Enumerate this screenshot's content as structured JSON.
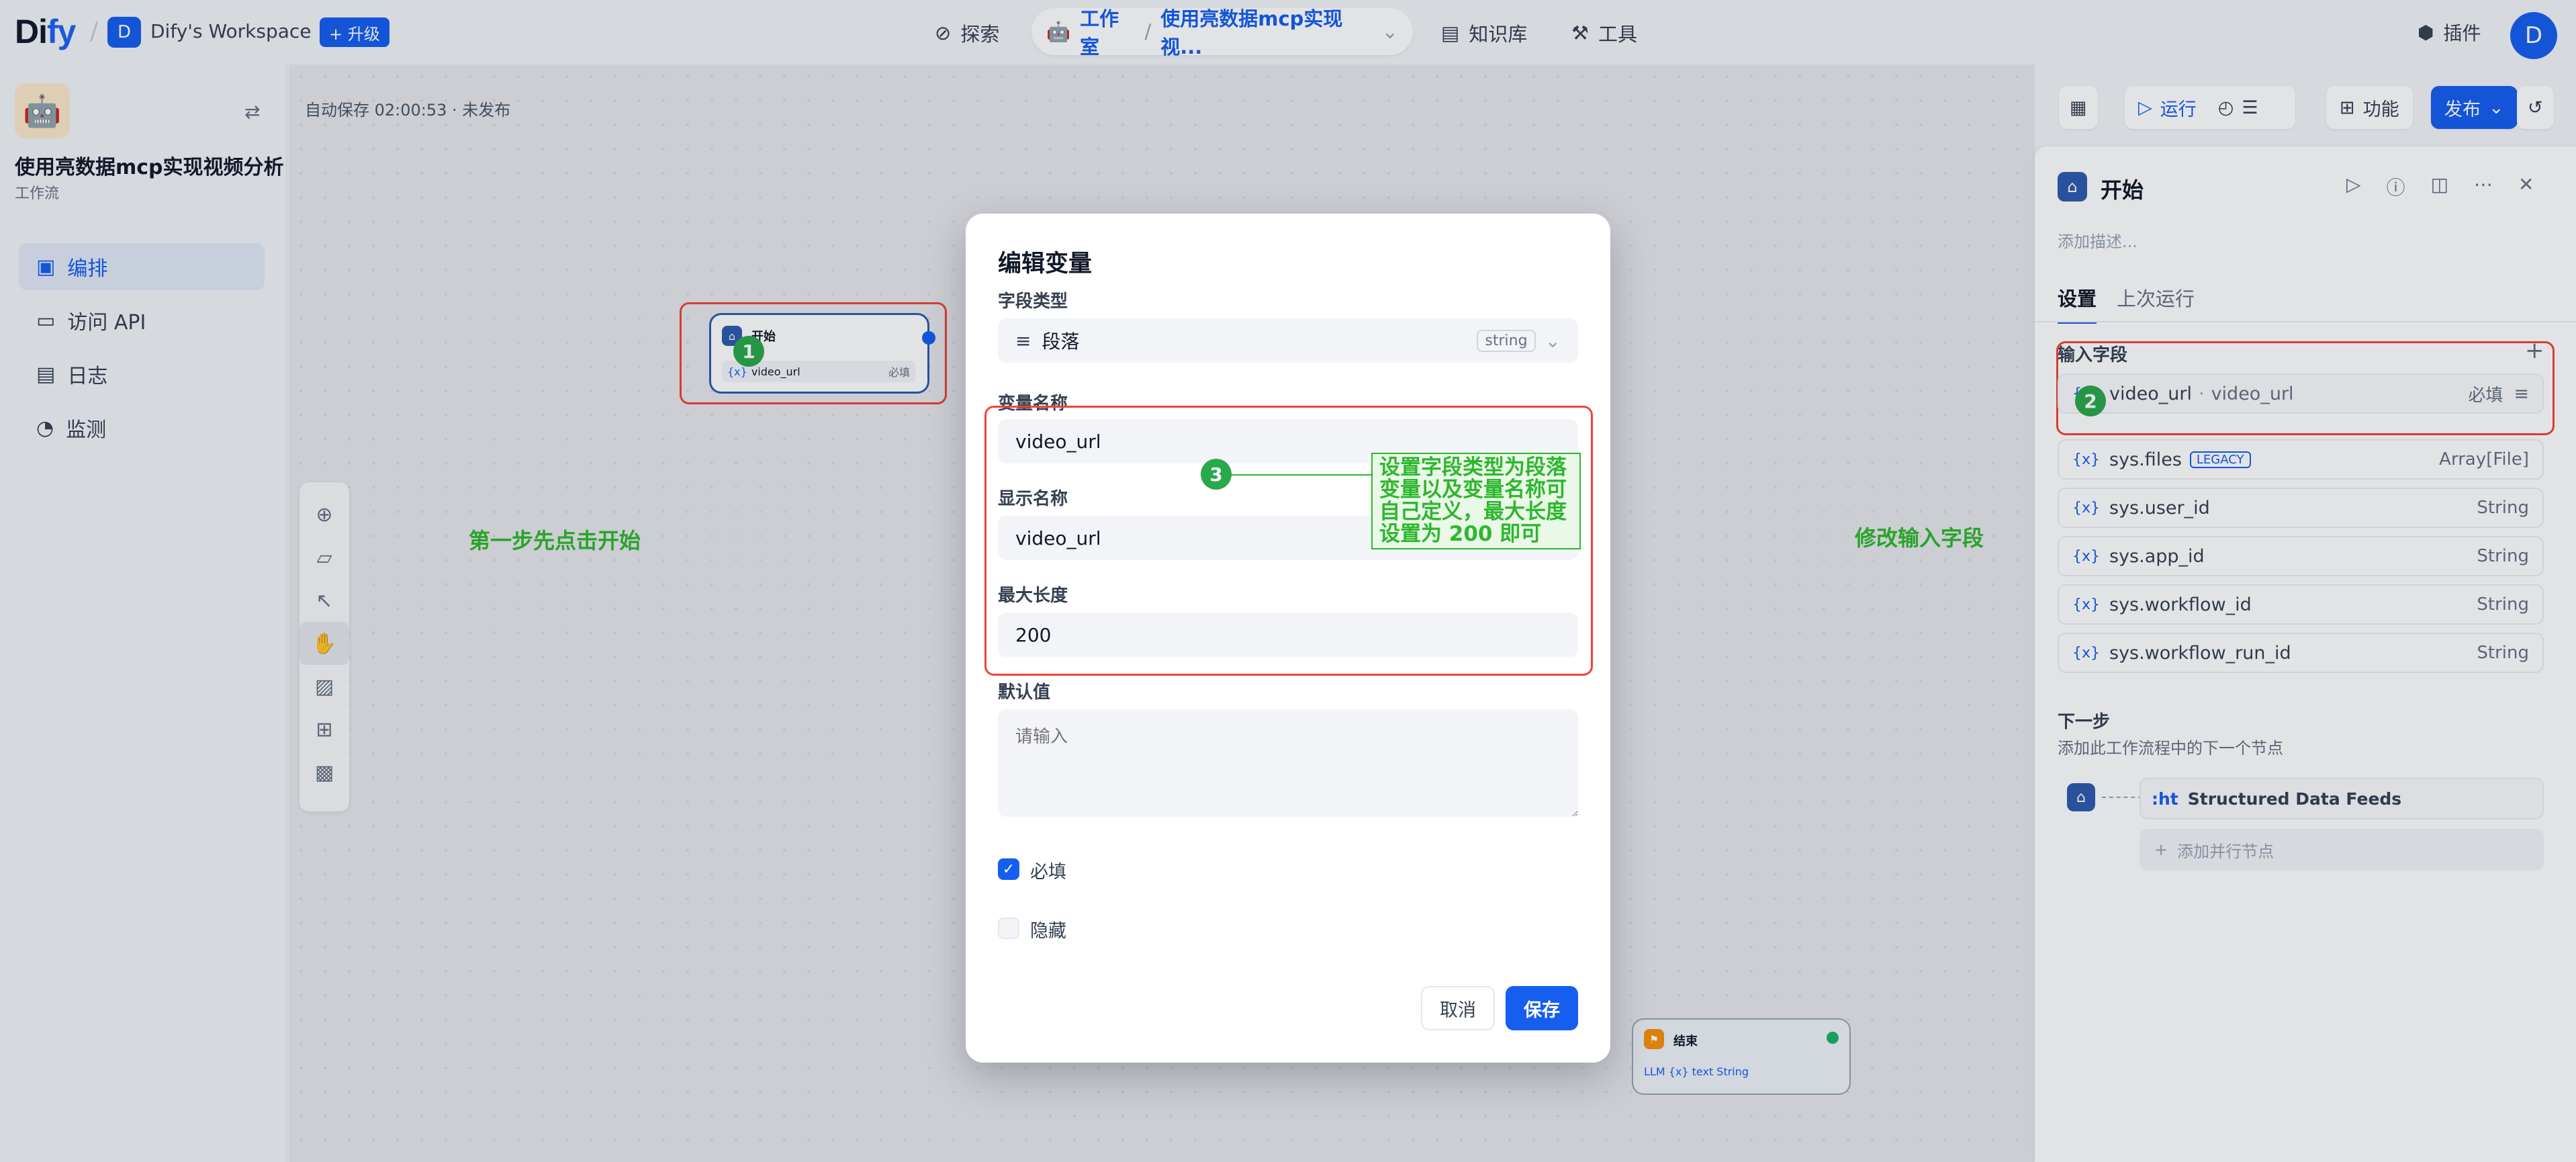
{
  "topbar": {
    "logo_main": "Di",
    "logo_accent": "fy",
    "workspace_initial": "D",
    "workspace_name": "Dify's Workspace",
    "upgrade_label": "+ 升级",
    "nav_explore": "探索",
    "nav_studio": "工作室",
    "nav_app": "使用亮数据mcp实现视...",
    "nav_knowledge": "知识库",
    "nav_tools": "工具",
    "plugins": "插件",
    "user_initial": "D"
  },
  "sidebar": {
    "app_icon": "🤖",
    "app_name": "使用亮数据mcp实现视频分析",
    "app_type": "工作流",
    "items": [
      {
        "label": "编排",
        "icon": "layout-icon"
      },
      {
        "label": "访问 API",
        "icon": "terminal-icon"
      },
      {
        "label": "日志",
        "icon": "file-icon"
      },
      {
        "label": "监测",
        "icon": "gauge-icon"
      }
    ]
  },
  "canvas": {
    "autosave": "自动保存 02:00:53 · 未发布",
    "start_node": {
      "title": "开始",
      "var": "video_url",
      "required": "必填"
    },
    "end_node": {
      "title": "结束",
      "output": "LLM {x} text String"
    },
    "annotation_step1": "第一步先点击开始",
    "annotation_modify": "修改输入字段",
    "callout_text": "设置字段类型为段落变量以及变量名称可自己定义，最大长度设置为 200 即可",
    "num1": "1",
    "num2": "2",
    "num3": "3"
  },
  "header_actions": {
    "run": "运行",
    "features": "功能",
    "publish": "发布"
  },
  "panel": {
    "title": "开始",
    "desc_placeholder": "添加描述...",
    "tab_settings": "设置",
    "tab_last_run": "上次运行",
    "input_fields_label": "输入字段",
    "field_row": {
      "name": "video_url",
      "label": "video_url",
      "required": "必填"
    },
    "sys_vars": [
      {
        "name": "sys.files",
        "badge": "LEGACY",
        "type": "Array[File]"
      },
      {
        "name": "sys.user_id",
        "badge": "",
        "type": "String"
      },
      {
        "name": "sys.app_id",
        "badge": "",
        "type": "String"
      },
      {
        "name": "sys.workflow_id",
        "badge": "",
        "type": "String"
      },
      {
        "name": "sys.workflow_run_id",
        "badge": "",
        "type": "String"
      }
    ],
    "next_step_title": "下一步",
    "next_step_desc": "添加此工作流程中的下一个节点",
    "next_node": "Structured Data Feeds",
    "add_parallel": "添加并行节点"
  },
  "modal": {
    "title": "编辑变量",
    "field_type_label": "字段类型",
    "field_type_value": "段落",
    "field_type_badge": "string",
    "var_name_label": "变量名称",
    "var_name_value": "video_url",
    "display_name_label": "显示名称",
    "display_name_value": "video_url",
    "max_length_label": "最大长度",
    "max_length_value": "200",
    "default_label": "默认值",
    "default_placeholder": "请输入",
    "required_label": "必填",
    "required_checked": true,
    "hidden_label": "隐藏",
    "hidden_checked": false,
    "cancel": "取消",
    "save": "保存"
  }
}
